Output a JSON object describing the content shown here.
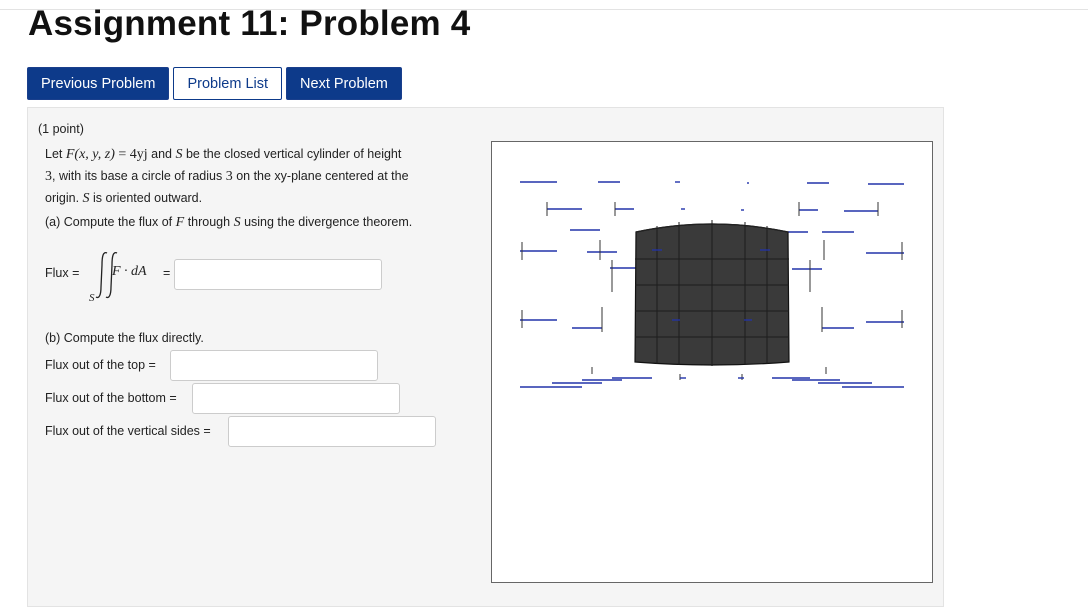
{
  "page": {
    "title": "Assignment 11: Problem 4"
  },
  "nav": {
    "previous": "Previous Problem",
    "list": "Problem List",
    "next": "Next Problem"
  },
  "problem": {
    "points": "(1 point)",
    "line1_let": "Let",
    "line1_func": "F(x, y, z)",
    "line1_eq": "= 4yj",
    "line1_and": "and",
    "line1_S": "S",
    "line1_rest": "be the closed vertical cylinder of height",
    "line2_3": "3",
    "line2_rest": ", with its base a circle of radius",
    "line2_3b": "3",
    "line2_rest2": "on the xy-plane centered at the",
    "line3_origin": "origin.",
    "line3_S": "S",
    "line3_rest": "is oriented outward.",
    "part_a_pre": "(a) Compute the flux of",
    "part_a_F": "F",
    "part_a_mid": "through",
    "part_a_S": "S",
    "part_a_post": "using the divergence theorem.",
    "flux_label": "Flux =",
    "integral_body": "F · dA",
    "integral_eq": "=",
    "integral_sub": "S",
    "part_b": "(b) Compute the flux directly.",
    "top_label": "Flux out of the top =",
    "bottom_label": "Flux out of the bottom =",
    "sides_label": "Flux out of the vertical sides ="
  },
  "answers": {
    "flux": "",
    "top": "",
    "bottom": "",
    "sides": ""
  },
  "colors": {
    "primary_button": "#0d3a8a",
    "arrow": "#2233aa",
    "cylinder": "#3a3a3a"
  }
}
